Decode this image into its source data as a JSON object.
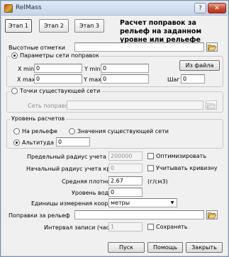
{
  "window": {
    "title": "RelMass",
    "help_label": "?",
    "close_label": "✕"
  },
  "tabs": [
    {
      "label": "Этап 1",
      "active": true
    },
    {
      "label": "Этап 2",
      "active": false
    },
    {
      "label": "Этап 3",
      "active": false
    }
  ],
  "heading": "Расчет поправок за рельеф на заданном уровне или рельефе",
  "heights": {
    "label": "Высотные отметки",
    "value": ""
  },
  "grid_params": {
    "legend": "Параметры сети поправок",
    "selected": true,
    "xmin_label": "X min",
    "xmin_value": "0",
    "xmax_label": "X max",
    "xmax_value": "0",
    "ymin_label": "Y min",
    "ymin_value": "0",
    "ymax_label": "Y max",
    "ymax_value": "0",
    "from_file_label": "Из файла",
    "step_label": "Шаг",
    "step_value": "0"
  },
  "existing_grid": {
    "legend": "Точки существующей сети",
    "selected": false,
    "net_label": "Сеть поправок",
    "net_value": ""
  },
  "calc_level": {
    "legend": "Уровень расчетов",
    "relief_label": "На рельефе",
    "existing_values_label": "Значения существующей сети",
    "altitude_label": "Альтитуда",
    "altitude_value": "0"
  },
  "params": {
    "relief_radius_label": "Предельный радиус учета рельефа",
    "relief_radius_value": "200000",
    "optimize_label": "Оптимизировать",
    "curv_radius_label": "Начальный радиус учета кривизны",
    "curv_radius_value": "0",
    "account_curv_label": "Учитывать кривизну",
    "density_label": "Средняя плотность",
    "density_value": "2.67",
    "density_unit": "(г/см3)",
    "water_label": "Уровень воды",
    "water_value": "0",
    "units_label": "Единицы измерения координат",
    "units_value": "метры",
    "corrections_label": "Поправки за рельеф",
    "corrections_value": "",
    "interval_label": "Интервал записи (часы)",
    "interval_value": "1",
    "save_label": "Сохранять"
  },
  "buttons": {
    "start": "Пуск",
    "help": "Помощь",
    "close": "Закрыть"
  },
  "icons": [
    "app-icon",
    "folder-open-icon",
    "help-icon",
    "close-icon",
    "chevron-down-icon"
  ]
}
